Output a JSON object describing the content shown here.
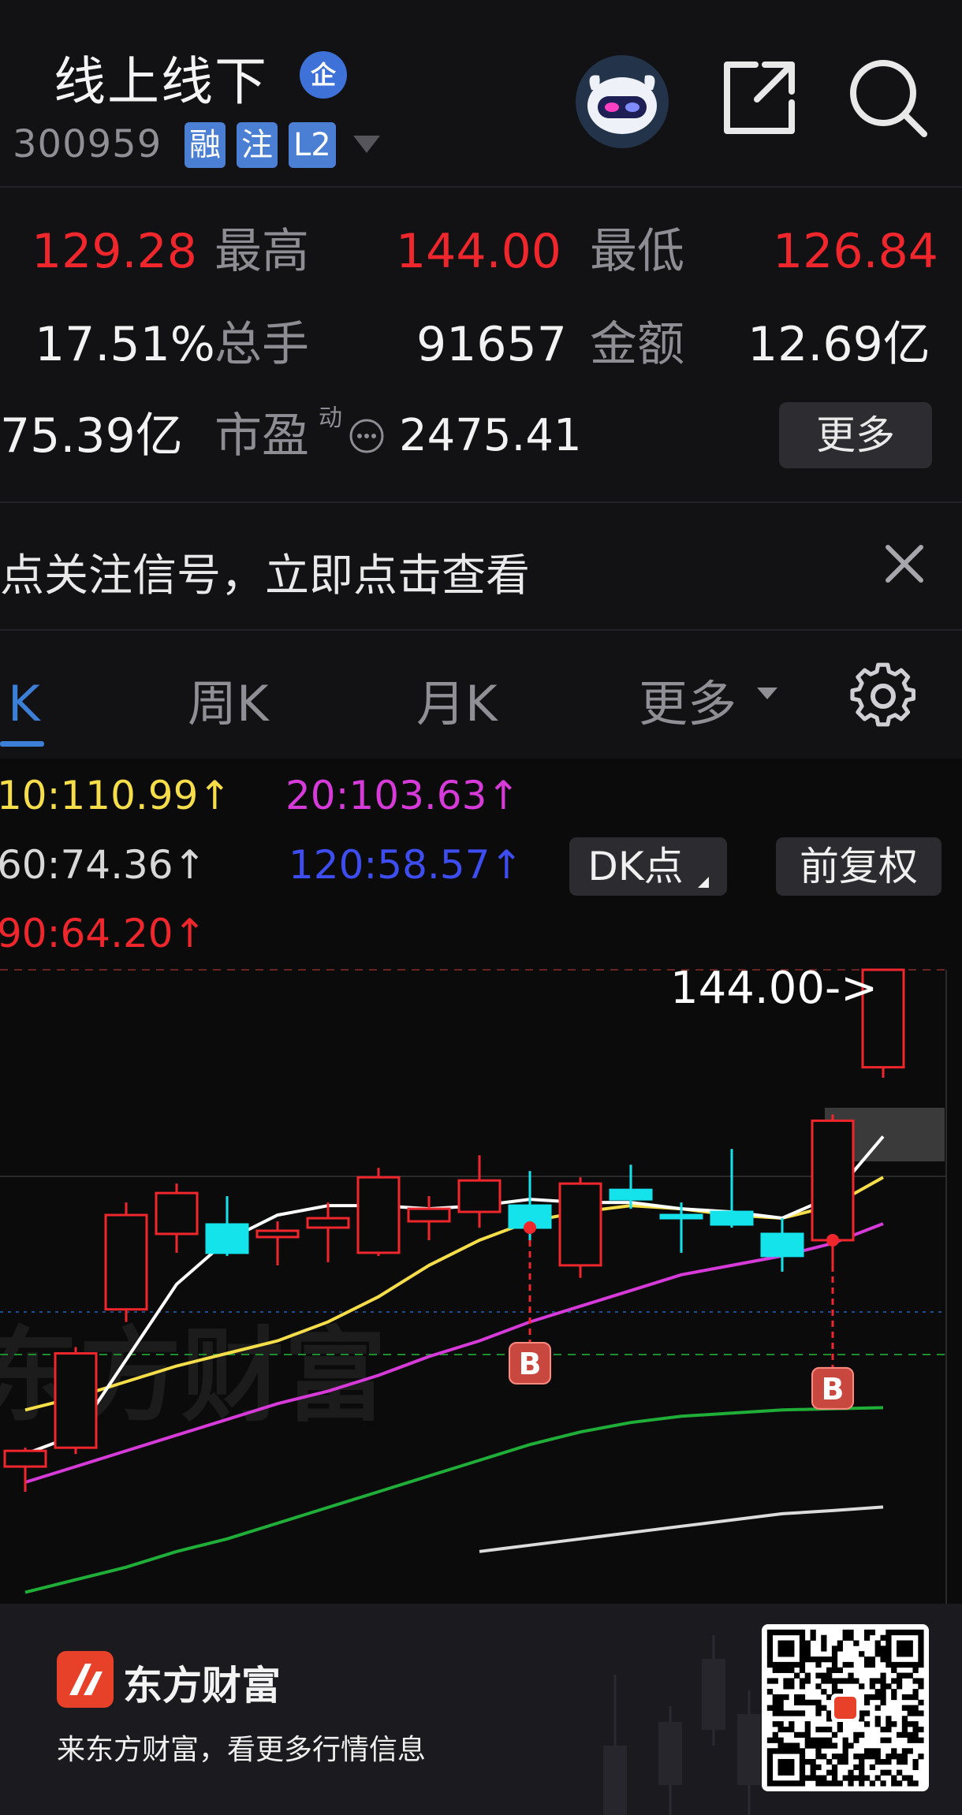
{
  "header": {
    "title": "线上线下",
    "enterprise_badge": "企",
    "code": "300959",
    "tags": [
      "融",
      "注",
      "L2"
    ]
  },
  "quote": {
    "row1": {
      "price": "129.28",
      "high_label": "最高",
      "high": "144.00",
      "low_label": "最低",
      "low": "126.84"
    },
    "row2": {
      "change_pct": "17.51%",
      "volume_label": "总手",
      "volume": "91657",
      "amount_label": "金额",
      "amount": "12.69亿"
    },
    "row3": {
      "market_cap": "75.39亿",
      "pe_label": "市盈",
      "pe_sup": "动",
      "pe": "2475.41",
      "more_button": "更多"
    }
  },
  "signal_banner": {
    "text": "点关注信号，立即点击查看"
  },
  "tabs": [
    {
      "label": "日K",
      "active": true
    },
    {
      "label": "周K",
      "active": false
    },
    {
      "label": "月K",
      "active": false
    },
    {
      "label": "更多",
      "active": false
    }
  ],
  "moving_averages": {
    "ma10": "10:110.99↑",
    "ma20": "20:103.63↑",
    "ma60": "60:74.36↑",
    "ma120": "120:58.57↑",
    "ma90": "90:64.20↑"
  },
  "chart_controls": {
    "dk_button": "DK点",
    "adjust_button": "前复权"
  },
  "chart": {
    "high_marker": "144.00->",
    "signal_label": "B",
    "watermark": "东方财富"
  },
  "colors": {
    "rise": "#f0262d",
    "fall": "#14e3ec",
    "ma5": "#ffffff",
    "ma10": "#f5de4a",
    "ma20": "#d63ad8",
    "ma60": "#1fae38",
    "ma120": "#3e4df0",
    "accent": "#3b7fd6"
  },
  "chart_data": {
    "type": "candlestick",
    "candles": [
      {
        "o": 65.0,
        "h": 68.0,
        "l": 61.0,
        "c": 67.5
      },
      {
        "o": 68.0,
        "h": 84.0,
        "l": 67.0,
        "c": 83.0
      },
      {
        "o": 90.0,
        "h": 107.0,
        "l": 88.0,
        "c": 105.0
      },
      {
        "o": 102.0,
        "h": 110.0,
        "l": 99.0,
        "c": 108.5
      },
      {
        "o": 103.5,
        "h": 108.0,
        "l": 98.5,
        "c": 99.0
      },
      {
        "o": 101.5,
        "h": 104.0,
        "l": 97.0,
        "c": 102.5
      },
      {
        "o": 103.0,
        "h": 107.0,
        "l": 97.5,
        "c": 104.5
      },
      {
        "o": 99.0,
        "h": 112.5,
        "l": 98.5,
        "c": 111.0
      },
      {
        "o": 104.0,
        "h": 108.0,
        "l": 101.0,
        "c": 106.0
      },
      {
        "o": 105.5,
        "h": 114.5,
        "l": 103.0,
        "c": 110.5
      },
      {
        "o": 106.5,
        "h": 112.0,
        "l": 101.0,
        "c": 103.0
      },
      {
        "o": 97.0,
        "h": 111.0,
        "l": 95.0,
        "c": 110.0
      },
      {
        "o": 109.0,
        "h": 113.0,
        "l": 106.0,
        "c": 107.5
      },
      {
        "o": 105.0,
        "h": 107.0,
        "l": 99.0,
        "c": 104.5
      },
      {
        "o": 105.5,
        "h": 115.5,
        "l": 103.0,
        "c": 103.5
      },
      {
        "o": 102.0,
        "h": 104.5,
        "l": 96.0,
        "c": 98.5
      },
      {
        "o": 101.0,
        "h": 121.0,
        "l": 97.0,
        "c": 120.0
      },
      {
        "o": 128.5,
        "h": 144.0,
        "l": 126.84,
        "c": 144.0
      }
    ],
    "ma5": [
      67.0,
      70.0,
      82.0,
      94.0,
      101.0,
      105.0,
      106.5,
      106.5,
      106.0,
      106.5,
      107.5,
      107.0,
      107.0,
      106.0,
      105.5,
      104.5,
      108.0,
      117.5
    ],
    "ma10": [
      74.0,
      76.0,
      78.5,
      81.0,
      83.0,
      85.0,
      88.0,
      92.0,
      97.0,
      101.0,
      104.0,
      105.5,
      106.5,
      106.0,
      105.0,
      104.5,
      106.5,
      111.0
    ],
    "ma20": [
      62.5,
      65.0,
      67.5,
      70.0,
      72.5,
      75.0,
      77.0,
      79.5,
      82.5,
      85.0,
      88.0,
      90.5,
      93.0,
      95.5,
      97.0,
      98.5,
      100.5,
      103.63
    ],
    "ma60": [
      45.0,
      47.0,
      49.0,
      51.5,
      53.5,
      56.0,
      58.5,
      61.0,
      63.5,
      66.0,
      68.5,
      70.5,
      72.0,
      73.0,
      73.5,
      74.0,
      74.2,
      74.36
    ],
    "ma120": [
      null,
      null,
      null,
      null,
      null,
      null,
      null,
      null,
      null,
      51.5,
      52.5,
      53.5,
      54.5,
      55.5,
      56.5,
      57.5,
      58.0,
      58.57
    ],
    "signals": [
      {
        "index": 10,
        "label": "B"
      },
      {
        "index": 16,
        "label": "B"
      }
    ],
    "y_range": [
      44,
      150
    ],
    "high_value": 144.0
  },
  "footer": {
    "brand": "东方财富",
    "slogan": "来东方财富，看更多行情信息"
  }
}
